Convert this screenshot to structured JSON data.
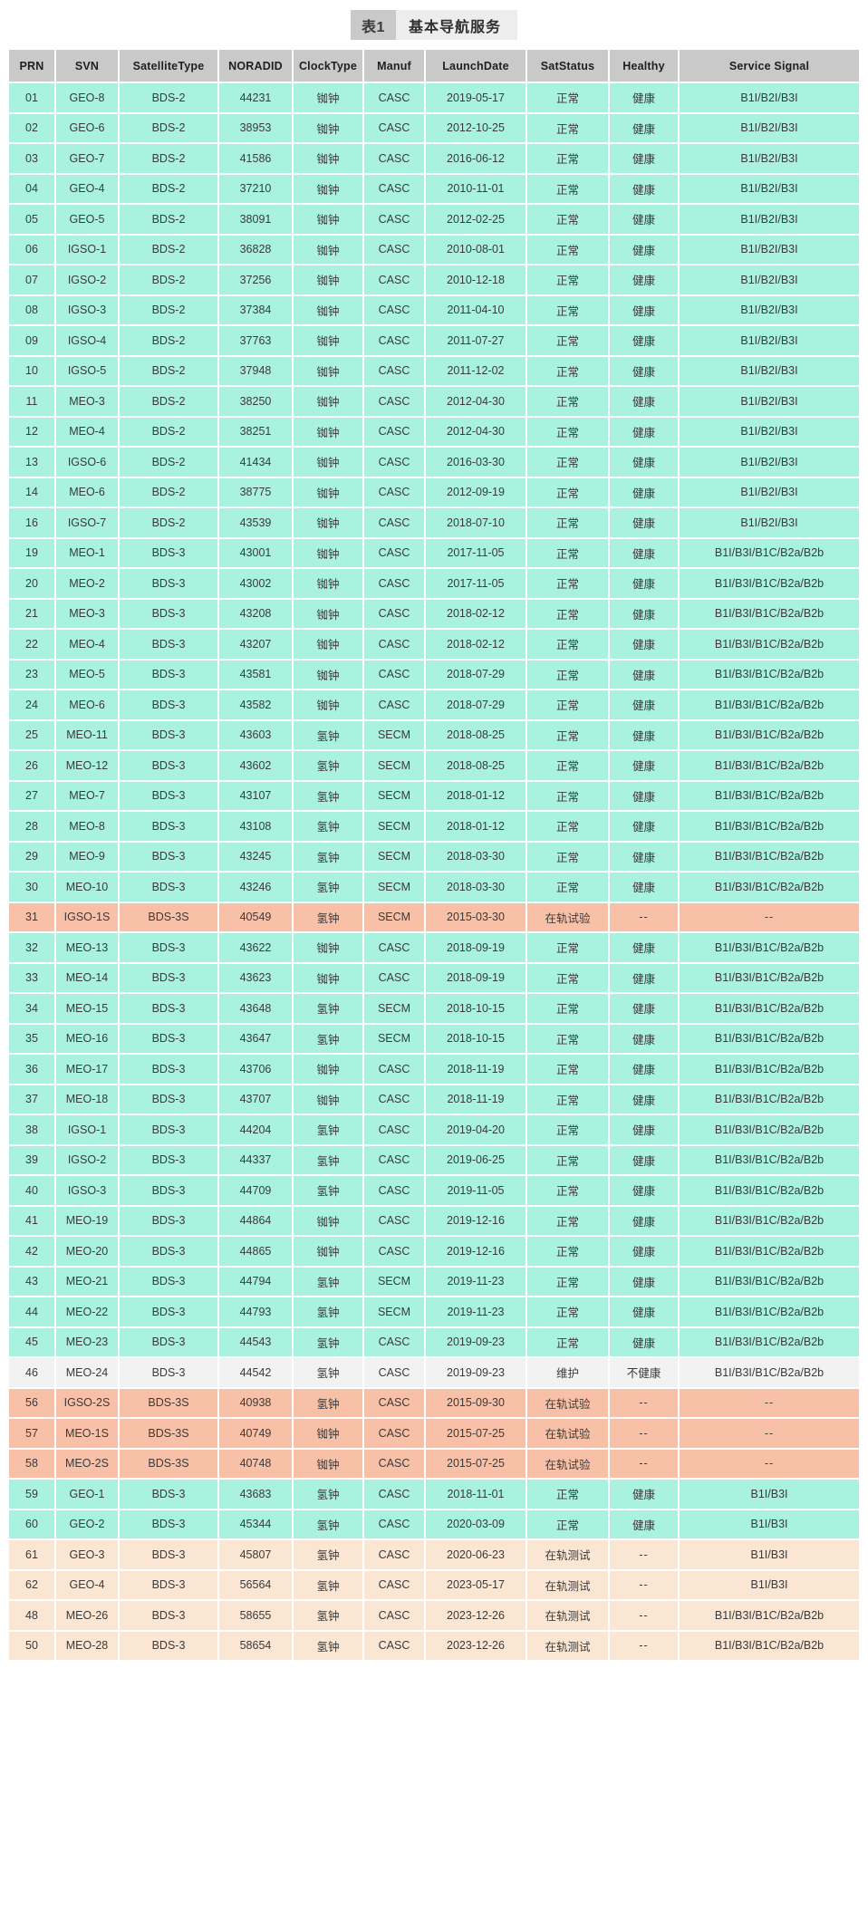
{
  "title": {
    "badge": "表1",
    "text": "基本导航服务"
  },
  "table": {
    "columns": [
      "PRN",
      "SVN",
      "SatelliteType",
      "NORADID",
      "ClockType",
      "Manuf",
      "LaunchDate",
      "SatStatus",
      "Healthy",
      "Service Signal"
    ],
    "row_colors": {
      "normal": "#aaf2e0",
      "test": "#f9c0a8",
      "testing": "#fae6d2",
      "maintenance": "#f2f2f2",
      "header": "#c9c9c9"
    },
    "rows": [
      {
        "state": "normal",
        "cells": [
          "01",
          "GEO-8",
          "BDS-2",
          "44231",
          "铷钟",
          "CASC",
          "2019-05-17",
          "正常",
          "健康",
          "B1I/B2I/B3I"
        ]
      },
      {
        "state": "normal",
        "cells": [
          "02",
          "GEO-6",
          "BDS-2",
          "38953",
          "铷钟",
          "CASC",
          "2012-10-25",
          "正常",
          "健康",
          "B1I/B2I/B3I"
        ]
      },
      {
        "state": "normal",
        "cells": [
          "03",
          "GEO-7",
          "BDS-2",
          "41586",
          "铷钟",
          "CASC",
          "2016-06-12",
          "正常",
          "健康",
          "B1I/B2I/B3I"
        ]
      },
      {
        "state": "normal",
        "cells": [
          "04",
          "GEO-4",
          "BDS-2",
          "37210",
          "铷钟",
          "CASC",
          "2010-11-01",
          "正常",
          "健康",
          "B1I/B2I/B3I"
        ]
      },
      {
        "state": "normal",
        "cells": [
          "05",
          "GEO-5",
          "BDS-2",
          "38091",
          "铷钟",
          "CASC",
          "2012-02-25",
          "正常",
          "健康",
          "B1I/B2I/B3I"
        ]
      },
      {
        "state": "normal",
        "cells": [
          "06",
          "IGSO-1",
          "BDS-2",
          "36828",
          "铷钟",
          "CASC",
          "2010-08-01",
          "正常",
          "健康",
          "B1I/B2I/B3I"
        ]
      },
      {
        "state": "normal",
        "cells": [
          "07",
          "IGSO-2",
          "BDS-2",
          "37256",
          "铷钟",
          "CASC",
          "2010-12-18",
          "正常",
          "健康",
          "B1I/B2I/B3I"
        ]
      },
      {
        "state": "normal",
        "cells": [
          "08",
          "IGSO-3",
          "BDS-2",
          "37384",
          "铷钟",
          "CASC",
          "2011-04-10",
          "正常",
          "健康",
          "B1I/B2I/B3I"
        ]
      },
      {
        "state": "normal",
        "cells": [
          "09",
          "IGSO-4",
          "BDS-2",
          "37763",
          "铷钟",
          "CASC",
          "2011-07-27",
          "正常",
          "健康",
          "B1I/B2I/B3I"
        ]
      },
      {
        "state": "normal",
        "cells": [
          "10",
          "IGSO-5",
          "BDS-2",
          "37948",
          "铷钟",
          "CASC",
          "2011-12-02",
          "正常",
          "健康",
          "B1I/B2I/B3I"
        ]
      },
      {
        "state": "normal",
        "cells": [
          "11",
          "MEO-3",
          "BDS-2",
          "38250",
          "铷钟",
          "CASC",
          "2012-04-30",
          "正常",
          "健康",
          "B1I/B2I/B3I"
        ]
      },
      {
        "state": "normal",
        "cells": [
          "12",
          "MEO-4",
          "BDS-2",
          "38251",
          "铷钟",
          "CASC",
          "2012-04-30",
          "正常",
          "健康",
          "B1I/B2I/B3I"
        ]
      },
      {
        "state": "normal",
        "cells": [
          "13",
          "IGSO-6",
          "BDS-2",
          "41434",
          "铷钟",
          "CASC",
          "2016-03-30",
          "正常",
          "健康",
          "B1I/B2I/B3I"
        ]
      },
      {
        "state": "normal",
        "cells": [
          "14",
          "MEO-6",
          "BDS-2",
          "38775",
          "铷钟",
          "CASC",
          "2012-09-19",
          "正常",
          "健康",
          "B1I/B2I/B3I"
        ]
      },
      {
        "state": "normal",
        "cells": [
          "16",
          "IGSO-7",
          "BDS-2",
          "43539",
          "铷钟",
          "CASC",
          "2018-07-10",
          "正常",
          "健康",
          "B1I/B2I/B3I"
        ]
      },
      {
        "state": "normal",
        "cells": [
          "19",
          "MEO-1",
          "BDS-3",
          "43001",
          "铷钟",
          "CASC",
          "2017-11-05",
          "正常",
          "健康",
          "B1I/B3I/B1C/B2a/B2b"
        ]
      },
      {
        "state": "normal",
        "cells": [
          "20",
          "MEO-2",
          "BDS-3",
          "43002",
          "铷钟",
          "CASC",
          "2017-11-05",
          "正常",
          "健康",
          "B1I/B3I/B1C/B2a/B2b"
        ]
      },
      {
        "state": "normal",
        "cells": [
          "21",
          "MEO-3",
          "BDS-3",
          "43208",
          "铷钟",
          "CASC",
          "2018-02-12",
          "正常",
          "健康",
          "B1I/B3I/B1C/B2a/B2b"
        ]
      },
      {
        "state": "normal",
        "cells": [
          "22",
          "MEO-4",
          "BDS-3",
          "43207",
          "铷钟",
          "CASC",
          "2018-02-12",
          "正常",
          "健康",
          "B1I/B3I/B1C/B2a/B2b"
        ]
      },
      {
        "state": "normal",
        "cells": [
          "23",
          "MEO-5",
          "BDS-3",
          "43581",
          "铷钟",
          "CASC",
          "2018-07-29",
          "正常",
          "健康",
          "B1I/B3I/B1C/B2a/B2b"
        ]
      },
      {
        "state": "normal",
        "cells": [
          "24",
          "MEO-6",
          "BDS-3",
          "43582",
          "铷钟",
          "CASC",
          "2018-07-29",
          "正常",
          "健康",
          "B1I/B3I/B1C/B2a/B2b"
        ]
      },
      {
        "state": "normal",
        "cells": [
          "25",
          "MEO-11",
          "BDS-3",
          "43603",
          "氢钟",
          "SECM",
          "2018-08-25",
          "正常",
          "健康",
          "B1I/B3I/B1C/B2a/B2b"
        ]
      },
      {
        "state": "normal",
        "cells": [
          "26",
          "MEO-12",
          "BDS-3",
          "43602",
          "氢钟",
          "SECM",
          "2018-08-25",
          "正常",
          "健康",
          "B1I/B3I/B1C/B2a/B2b"
        ]
      },
      {
        "state": "normal",
        "cells": [
          "27",
          "MEO-7",
          "BDS-3",
          "43107",
          "氢钟",
          "SECM",
          "2018-01-12",
          "正常",
          "健康",
          "B1I/B3I/B1C/B2a/B2b"
        ]
      },
      {
        "state": "normal",
        "cells": [
          "28",
          "MEO-8",
          "BDS-3",
          "43108",
          "氢钟",
          "SECM",
          "2018-01-12",
          "正常",
          "健康",
          "B1I/B3I/B1C/B2a/B2b"
        ]
      },
      {
        "state": "normal",
        "cells": [
          "29",
          "MEO-9",
          "BDS-3",
          "43245",
          "氢钟",
          "SECM",
          "2018-03-30",
          "正常",
          "健康",
          "B1I/B3I/B1C/B2a/B2b"
        ]
      },
      {
        "state": "normal",
        "cells": [
          "30",
          "MEO-10",
          "BDS-3",
          "43246",
          "氢钟",
          "SECM",
          "2018-03-30",
          "正常",
          "健康",
          "B1I/B3I/B1C/B2a/B2b"
        ]
      },
      {
        "state": "test",
        "cells": [
          "31",
          "IGSO-1S",
          "BDS-3S",
          "40549",
          "氢钟",
          "SECM",
          "2015-03-30",
          "在轨试验",
          "--",
          "--"
        ]
      },
      {
        "state": "normal",
        "cells": [
          "32",
          "MEO-13",
          "BDS-3",
          "43622",
          "铷钟",
          "CASC",
          "2018-09-19",
          "正常",
          "健康",
          "B1I/B3I/B1C/B2a/B2b"
        ]
      },
      {
        "state": "normal",
        "cells": [
          "33",
          "MEO-14",
          "BDS-3",
          "43623",
          "铷钟",
          "CASC",
          "2018-09-19",
          "正常",
          "健康",
          "B1I/B3I/B1C/B2a/B2b"
        ]
      },
      {
        "state": "normal",
        "cells": [
          "34",
          "MEO-15",
          "BDS-3",
          "43648",
          "氢钟",
          "SECM",
          "2018-10-15",
          "正常",
          "健康",
          "B1I/B3I/B1C/B2a/B2b"
        ]
      },
      {
        "state": "normal",
        "cells": [
          "35",
          "MEO-16",
          "BDS-3",
          "43647",
          "氢钟",
          "SECM",
          "2018-10-15",
          "正常",
          "健康",
          "B1I/B3I/B1C/B2a/B2b"
        ]
      },
      {
        "state": "normal",
        "cells": [
          "36",
          "MEO-17",
          "BDS-3",
          "43706",
          "铷钟",
          "CASC",
          "2018-11-19",
          "正常",
          "健康",
          "B1I/B3I/B1C/B2a/B2b"
        ]
      },
      {
        "state": "normal",
        "cells": [
          "37",
          "MEO-18",
          "BDS-3",
          "43707",
          "铷钟",
          "CASC",
          "2018-11-19",
          "正常",
          "健康",
          "B1I/B3I/B1C/B2a/B2b"
        ]
      },
      {
        "state": "normal",
        "cells": [
          "38",
          "IGSO-1",
          "BDS-3",
          "44204",
          "氢钟",
          "CASC",
          "2019-04-20",
          "正常",
          "健康",
          "B1I/B3I/B1C/B2a/B2b"
        ]
      },
      {
        "state": "normal",
        "cells": [
          "39",
          "IGSO-2",
          "BDS-3",
          "44337",
          "氢钟",
          "CASC",
          "2019-06-25",
          "正常",
          "健康",
          "B1I/B3I/B1C/B2a/B2b"
        ]
      },
      {
        "state": "normal",
        "cells": [
          "40",
          "IGSO-3",
          "BDS-3",
          "44709",
          "氢钟",
          "CASC",
          "2019-11-05",
          "正常",
          "健康",
          "B1I/B3I/B1C/B2a/B2b"
        ]
      },
      {
        "state": "normal",
        "cells": [
          "41",
          "MEO-19",
          "BDS-3",
          "44864",
          "铷钟",
          "CASC",
          "2019-12-16",
          "正常",
          "健康",
          "B1I/B3I/B1C/B2a/B2b"
        ]
      },
      {
        "state": "normal",
        "cells": [
          "42",
          "MEO-20",
          "BDS-3",
          "44865",
          "铷钟",
          "CASC",
          "2019-12-16",
          "正常",
          "健康",
          "B1I/B3I/B1C/B2a/B2b"
        ]
      },
      {
        "state": "normal",
        "cells": [
          "43",
          "MEO-21",
          "BDS-3",
          "44794",
          "氢钟",
          "SECM",
          "2019-11-23",
          "正常",
          "健康",
          "B1I/B3I/B1C/B2a/B2b"
        ]
      },
      {
        "state": "normal",
        "cells": [
          "44",
          "MEO-22",
          "BDS-3",
          "44793",
          "氢钟",
          "SECM",
          "2019-11-23",
          "正常",
          "健康",
          "B1I/B3I/B1C/B2a/B2b"
        ]
      },
      {
        "state": "normal",
        "cells": [
          "45",
          "MEO-23",
          "BDS-3",
          "44543",
          "氢钟",
          "CASC",
          "2019-09-23",
          "正常",
          "健康",
          "B1I/B3I/B1C/B2a/B2b"
        ]
      },
      {
        "state": "maintenance",
        "cells": [
          "46",
          "MEO-24",
          "BDS-3",
          "44542",
          "氢钟",
          "CASC",
          "2019-09-23",
          "维护",
          "不健康",
          "B1I/B3I/B1C/B2a/B2b"
        ]
      },
      {
        "state": "test",
        "cells": [
          "56",
          "IGSO-2S",
          "BDS-3S",
          "40938",
          "氢钟",
          "CASC",
          "2015-09-30",
          "在轨试验",
          "--",
          "--"
        ]
      },
      {
        "state": "test",
        "cells": [
          "57",
          "MEO-1S",
          "BDS-3S",
          "40749",
          "铷钟",
          "CASC",
          "2015-07-25",
          "在轨试验",
          "--",
          "--"
        ]
      },
      {
        "state": "test",
        "cells": [
          "58",
          "MEO-2S",
          "BDS-3S",
          "40748",
          "铷钟",
          "CASC",
          "2015-07-25",
          "在轨试验",
          "--",
          "--"
        ]
      },
      {
        "state": "normal",
        "cells": [
          "59",
          "GEO-1",
          "BDS-3",
          "43683",
          "氢钟",
          "CASC",
          "2018-11-01",
          "正常",
          "健康",
          "B1I/B3I"
        ]
      },
      {
        "state": "normal",
        "cells": [
          "60",
          "GEO-2",
          "BDS-3",
          "45344",
          "氢钟",
          "CASC",
          "2020-03-09",
          "正常",
          "健康",
          "B1I/B3I"
        ]
      },
      {
        "state": "testing",
        "cells": [
          "61",
          "GEO-3",
          "BDS-3",
          "45807",
          "氢钟",
          "CASC",
          "2020-06-23",
          "在轨测试",
          "--",
          "B1I/B3I"
        ]
      },
      {
        "state": "testing",
        "cells": [
          "62",
          "GEO-4",
          "BDS-3",
          "56564",
          "氢钟",
          "CASC",
          "2023-05-17",
          "在轨测试",
          "--",
          "B1I/B3I"
        ]
      },
      {
        "state": "testing",
        "cells": [
          "48",
          "MEO-26",
          "BDS-3",
          "58655",
          "氢钟",
          "CASC",
          "2023-12-26",
          "在轨测试",
          "--",
          "B1I/B3I/B1C/B2a/B2b"
        ]
      },
      {
        "state": "testing",
        "cells": [
          "50",
          "MEO-28",
          "BDS-3",
          "58654",
          "氢钟",
          "CASC",
          "2023-12-26",
          "在轨测试",
          "--",
          "B1I/B3I/B1C/B2a/B2b"
        ]
      }
    ]
  }
}
